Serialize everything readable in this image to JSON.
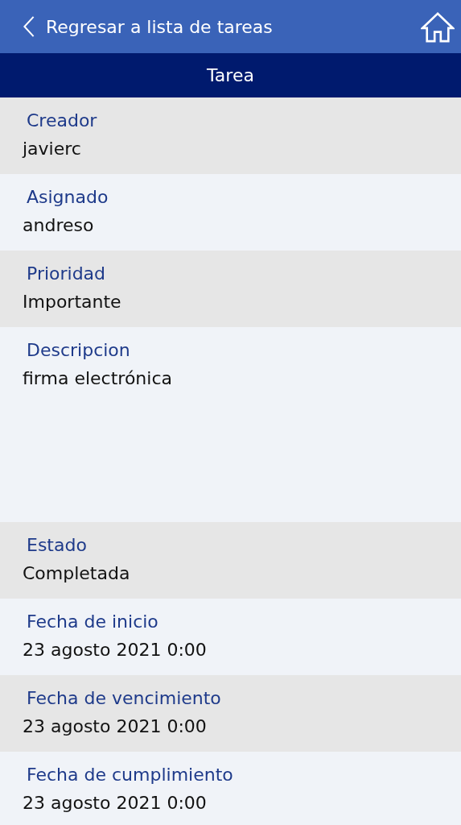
{
  "header": {
    "back_label": "Regresar a lista de tareas"
  },
  "title_bar": {
    "title": "Tarea"
  },
  "fields": [
    {
      "kind": "line",
      "label": "Creador",
      "value": "javierc"
    },
    {
      "kind": "line",
      "label": "Asignado",
      "value": "andreso"
    },
    {
      "kind": "line",
      "label": "Prioridad",
      "value": "Importante"
    },
    {
      "kind": "multiline",
      "label": "Descripcion",
      "value": "firma electrónica"
    },
    {
      "kind": "line",
      "label": "Estado",
      "value": "Completada"
    },
    {
      "kind": "line",
      "label": "Fecha de inicio",
      "value": "23 agosto 2021 0:00"
    },
    {
      "kind": "line",
      "label": "Fecha de vencimiento",
      "value": "23 agosto 2021 0:00"
    },
    {
      "kind": "line",
      "label": "Fecha de cumplimiento",
      "value": "23 agosto 2021 0:00"
    }
  ]
}
